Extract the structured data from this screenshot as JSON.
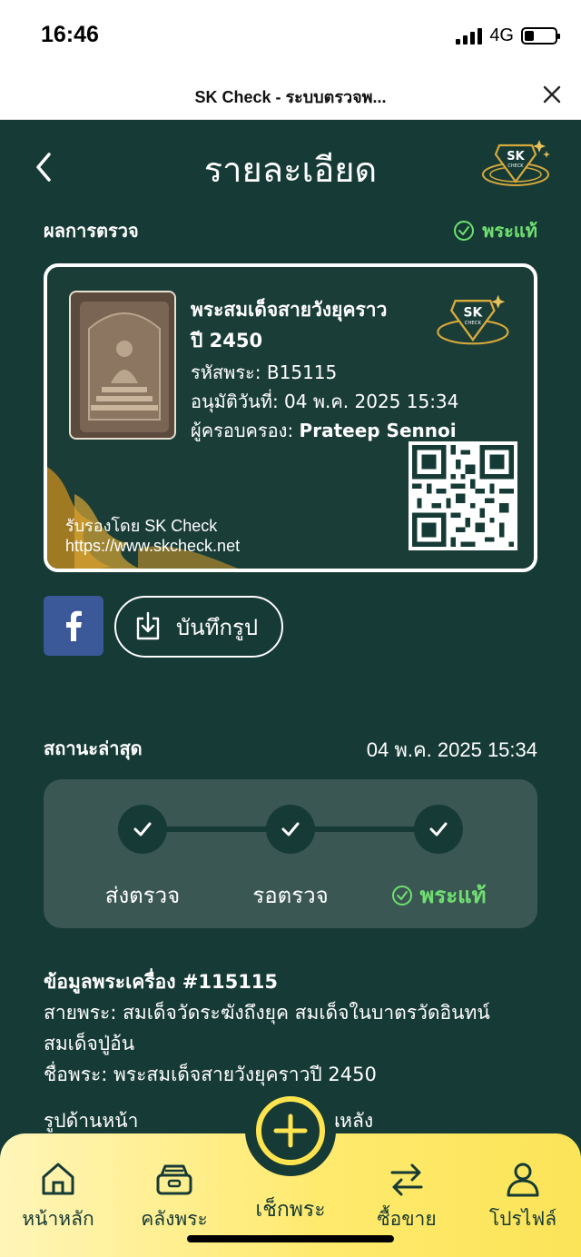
{
  "status_bar": {
    "time": "16:46",
    "network": "4G"
  },
  "browser": {
    "title": "SK Check - ระบบตรวจพ..."
  },
  "header": {
    "title": "รายละเอียด"
  },
  "result": {
    "label": "ผลการตรวจ",
    "badge": "พระแท้",
    "badge_color": "#6fe06f"
  },
  "card": {
    "title_line1": "พระสมเด็จสายวังยุคราว",
    "title_line2": "ปี 2450",
    "code_label": "รหัสพระ:",
    "code_value": "B15115",
    "approved_label": "อนุมัติวันที่:",
    "approved_value": "04 พ.ค. 2025 15:34",
    "owner_label": "ผู้ครอบครอง:",
    "owner_value": "Prateep Sennoi",
    "cert_line1": "รับรองโดย SK Check",
    "cert_line2": "https://www.skcheck.net"
  },
  "actions": {
    "save_label": "บันทึกรูป"
  },
  "latest_status": {
    "label": "สถานะล่าสุด",
    "date": "04 พ.ค. 2025 15:34",
    "steps": [
      "ส่งตรวจ",
      "รอตรวจ",
      "พระแท้"
    ]
  },
  "info": {
    "title": "ข้อมูลพระเครื่อง #115115",
    "line1": "สายพระ: สมเด็จวัดระฆังถึงยุค สมเด็จในบาตรวัดอินทน์",
    "line2": "สมเด็จปู่อ้น",
    "line3": "ชื่อพระ: พระสมเด็จสายวังยุคราวปี 2450",
    "front_label": "รูปด้านหน้า",
    "back_label": "านหลัง"
  },
  "nav": {
    "home": "หน้าหลัก",
    "vault": "คลังพระ",
    "check": "เช็กพระ",
    "trade": "ซื้อขาย",
    "profile": "โปรไฟล์"
  },
  "logo_text": "SK CHECK",
  "colors": {
    "bg": "#163a35",
    "accent": "#ffe44f",
    "success": "#6fe06f"
  }
}
